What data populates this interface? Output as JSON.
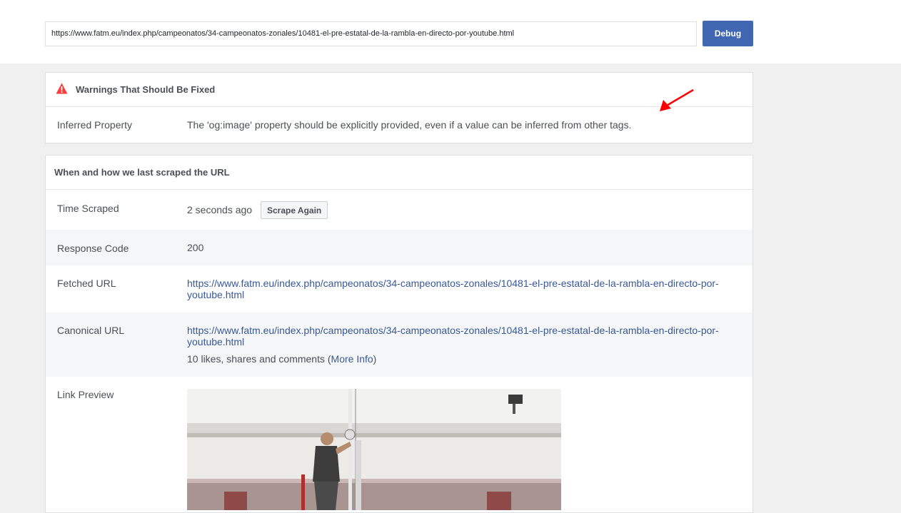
{
  "toolbar": {
    "url_value": "https://www.fatm.eu/index.php/campeonatos/34-campeonatos-zonales/10481-el-pre-estatal-de-la-rambla-en-directo-por-youtube.html",
    "debug_label": "Debug"
  },
  "warnings": {
    "title": "Warnings That Should Be Fixed",
    "rows": [
      {
        "label": "Inferred Property",
        "value": "The 'og:image' property should be explicitly provided, even if a value can be inferred from other tags."
      }
    ]
  },
  "scrape": {
    "title": "When and how we last scraped the URL",
    "time_scraped_label": "Time Scraped",
    "time_scraped_value": "2 seconds ago",
    "scrape_again_label": "Scrape Again",
    "response_code_label": "Response Code",
    "response_code_value": "200",
    "fetched_url_label": "Fetched URL",
    "fetched_url_line1": "https://www.fatm.eu/index.php/campeonatos/34-campeonatos-zonales/10481-el-pre-estatal-de-la-rambla-en-directo-por-",
    "fetched_url_line2": "youtube.html",
    "canonical_url_label": "Canonical URL",
    "canonical_url_line1": "https://www.fatm.eu/index.php/campeonatos/34-campeonatos-zonales/10481-el-pre-estatal-de-la-rambla-en-directo-por-",
    "canonical_url_line2": "youtube.html",
    "engagement_text": "10 likes, shares and comments (",
    "more_info_label": "More Info",
    "engagement_close": ")",
    "link_preview_label": "Link Preview"
  },
  "colors": {
    "accent": "#4267b2",
    "link": "#385898",
    "warning": "#fa3e3e",
    "annotation_arrow": "#ff0000"
  },
  "icons": {
    "warning": "warning-triangle-icon",
    "annotation": "red-arrow-icon"
  }
}
